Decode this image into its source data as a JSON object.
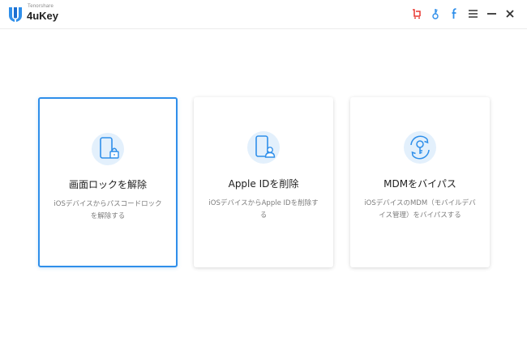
{
  "app": {
    "vendor": "Tenorshare",
    "name": "4uKey"
  },
  "titlebar": {
    "icons": [
      "cart-icon",
      "key-icon",
      "facebook-icon",
      "menu-icon",
      "minimize-icon",
      "close-icon"
    ],
    "colors": {
      "cart": "#e8352f",
      "key": "#2f8fea",
      "facebook": "#2f8fea",
      "control": "#333333"
    }
  },
  "cards": [
    {
      "title": "画面ロックを解除",
      "description": "iOSデバイスからパスコードロックを解除する",
      "icon": "phone-lock-icon",
      "selected": true
    },
    {
      "title": "Apple IDを削除",
      "description": "iOSデバイスからApple IDを削除する",
      "icon": "phone-person-icon",
      "selected": false
    },
    {
      "title": "MDMをバイパス",
      "description": "iOSデバイスのMDM（モバイルデバイス管理）をバイパスする",
      "icon": "mdm-key-icon",
      "selected": false
    }
  ],
  "colors": {
    "accent": "#2f8fea",
    "icon_bg": "#e3f0fc"
  }
}
